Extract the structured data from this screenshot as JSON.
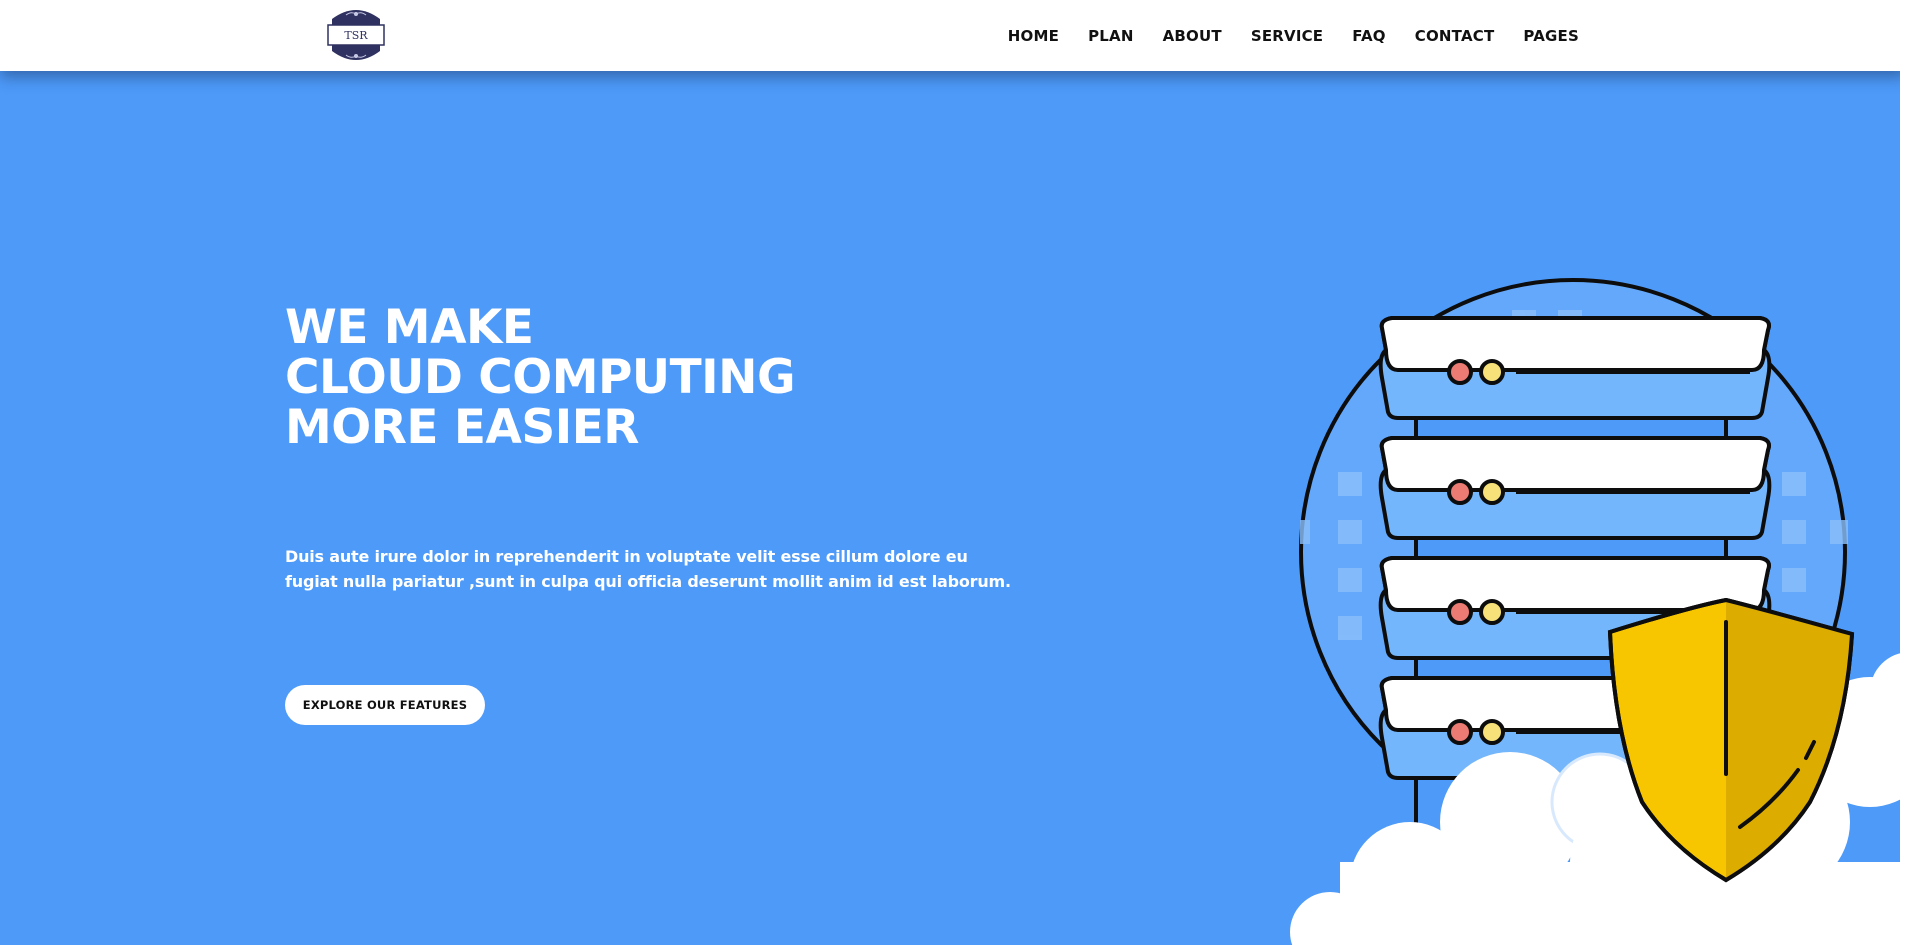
{
  "brand": {
    "logo_text": "TSR"
  },
  "nav": {
    "items": [
      {
        "label": "HOME"
      },
      {
        "label": "PLAN"
      },
      {
        "label": "ABOUT"
      },
      {
        "label": "SERVICE"
      },
      {
        "label": "FAQ"
      },
      {
        "label": "CONTACT"
      },
      {
        "label": "PAGES"
      }
    ]
  },
  "hero": {
    "title_lines": [
      "WE MAKE",
      "CLOUD COMPUTING",
      "MORE EASIER"
    ],
    "description": "Duis aute irure dolor in reprehenderit in voluptate velit esse cillum dolore eu fugiat nulla pariatur ,sunt in culpa qui officia deserunt mollit anim id est laborum.",
    "cta_label": "EXPLORE OUR FEATURES"
  },
  "colors": {
    "background": "#4d9af9",
    "navbar": "#ffffff",
    "server_panel": "#ffffff",
    "server_band": "#74b6fb",
    "led_red": "#ec7b74",
    "led_yellow": "#f7e27a",
    "shield_light": "#f7c600",
    "shield_dark": "#dcad00",
    "logo_navy": "#2f3160"
  },
  "icons": [
    "logo-badge",
    "server-rack-icon",
    "security-shield-icon",
    "cloud-decoration"
  ]
}
